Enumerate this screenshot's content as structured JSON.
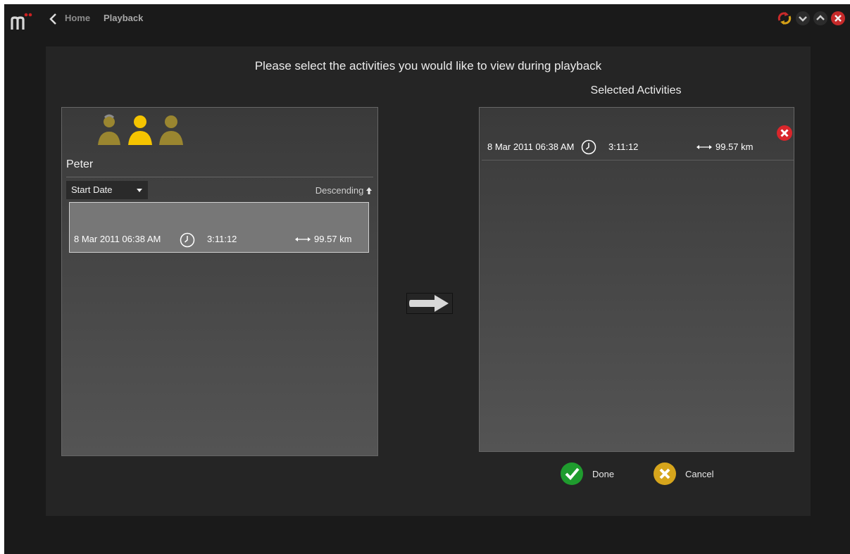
{
  "breadcrumb": {
    "home": "Home",
    "current": "Playback"
  },
  "window_controls": [
    "sync-icon",
    "minimize-icon",
    "maximize-icon",
    "close-icon"
  ],
  "dialog": {
    "prompt": "Please select the activities you would like to view during playback",
    "selected_title": "Selected Activities"
  },
  "left_panel": {
    "user_name": "Peter",
    "users": [
      "user-female-icon",
      "user-selected-icon",
      "user-icon"
    ],
    "sort": {
      "field": "Start Date",
      "order": "Descending"
    },
    "activities": [
      {
        "date": "8 Mar 2011 06:38 AM",
        "duration": "3:11:12",
        "distance": "99.57 km"
      }
    ]
  },
  "right_panel": {
    "selected": [
      {
        "date": "8 Mar 2011 06:38 AM",
        "duration": "3:11:12",
        "distance": "99.57 km"
      }
    ]
  },
  "actions": {
    "done": "Done",
    "cancel": "Cancel"
  },
  "colors": {
    "accent_yellow": "#f5c400",
    "muted_user": "#9a8630",
    "done_green": "#1f9c2e",
    "cancel_gold": "#d6a51c",
    "remove_red": "#d9262b"
  }
}
